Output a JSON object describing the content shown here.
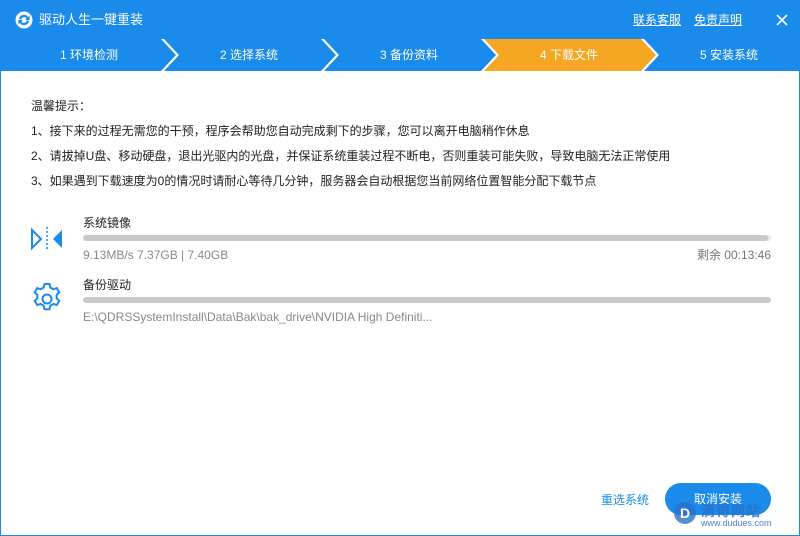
{
  "window": {
    "title": "驱动人生一键重装",
    "links": {
      "contact": "联系客服",
      "disclaimer": "免责声明"
    },
    "icons": {
      "logo": "app-logo-icon",
      "close": "close-icon"
    }
  },
  "steps": {
    "items": [
      {
        "label": "1 环境检测",
        "state": "done"
      },
      {
        "label": "2 选择系统",
        "state": "done"
      },
      {
        "label": "3 备份资料",
        "state": "done"
      },
      {
        "label": "4 下载文件",
        "state": "active"
      },
      {
        "label": "5 安装系统",
        "state": "pending"
      }
    ],
    "colors": {
      "done": "#1a8bea",
      "active": "#f5a623",
      "pending": "#1a8bea"
    }
  },
  "tips": {
    "title": "温馨提示：",
    "items": [
      "1、接下来的过程无需您的干预，程序会帮助您自动完成剩下的步骤，您可以离开电脑稍作休息",
      "2、请拔掉U盘、移动硬盘，退出光驱内的光盘，并保证系统重装过程不断电，否则重装可能失败，导致电脑无法正常使用",
      "3、如果遇到下载速度为0的情况时请耐心等待几分钟，服务器会自动根据您当前网络位置智能分配下载节点"
    ]
  },
  "tasks": {
    "image": {
      "name": "系统镜像",
      "detail": "9.13MB/s 7.37GB | 7.40GB",
      "remaining": "剩余 00:13:46",
      "progress": 0.996,
      "icon": "download-arrows-icon"
    },
    "driver": {
      "name": "备份驱动",
      "detail": "E:\\QDRSSystemInstall\\Data\\Bak\\bak_drive\\NVIDIA High Definiti...",
      "progress": 1.0,
      "icon": "gear-icon"
    }
  },
  "footer": {
    "reselect": "重选系统",
    "cancel": "取消安装"
  },
  "watermark": {
    "text": "滴得网站",
    "url": "www.dudues.com"
  },
  "colors": {
    "accent": "#1a8bea",
    "active_step": "#f5a623",
    "track": "#e6e6e6"
  }
}
